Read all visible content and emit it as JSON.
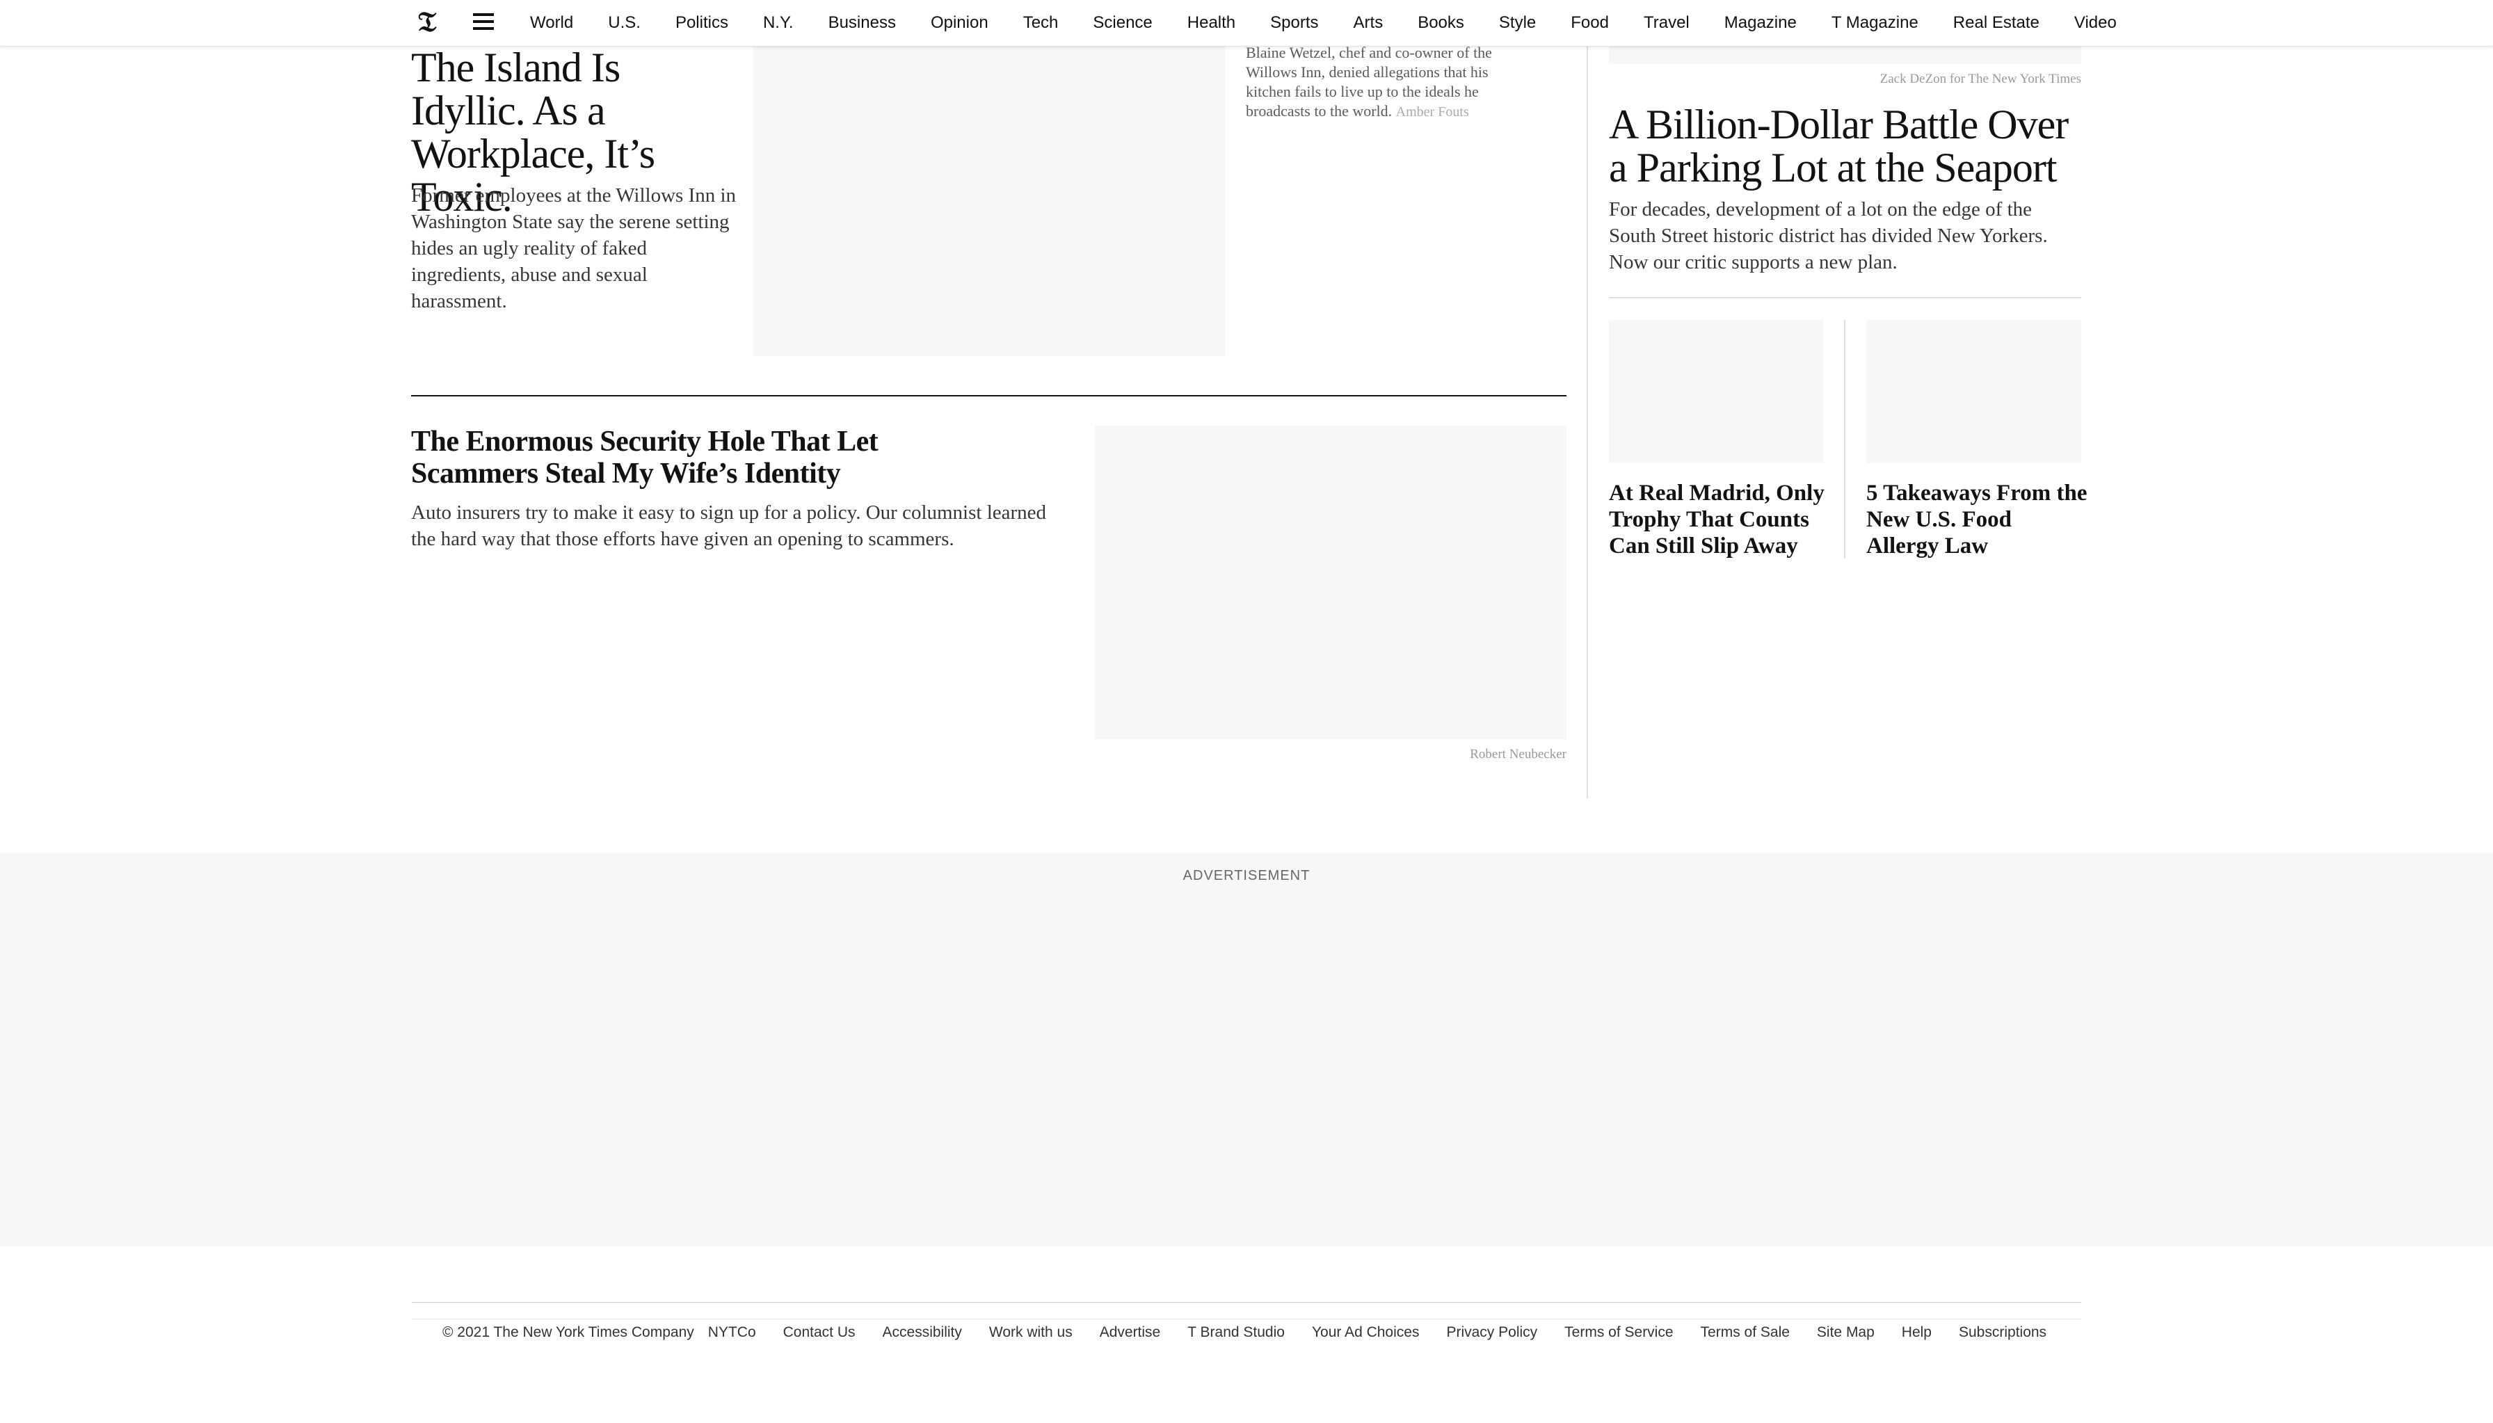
{
  "header": {
    "logo_icon": "nyt-logo-icon",
    "menu_icon": "hamburger-menu-icon",
    "nav": [
      "World",
      "U.S.",
      "Politics",
      "N.Y.",
      "Business",
      "Opinion",
      "Tech",
      "Science",
      "Health",
      "Sports",
      "Arts",
      "Books",
      "Style",
      "Food",
      "Travel",
      "Magazine",
      "T Magazine",
      "Real Estate",
      "Video"
    ]
  },
  "story_island": {
    "headline": "The Island Is Idyllic. As a Workplace, It’s Toxic.",
    "summary": "Former employees at the Willows Inn in Washington State say the serene setting hides an ugly reality of faked ingredients, abuse and sexual harassment.",
    "caption": "Blaine Wetzel, chef and co-owner of the Willows Inn, denied allegations that his kitchen fails to live up to the ideals he broadcasts to the world.",
    "credit": "Amber Fouts"
  },
  "story_security": {
    "headline": "The Enormous Security Hole That Let Scammers Steal My Wife’s Identity",
    "summary": "Auto insurers try to make it easy to sign up for a policy. Our columnist learned the hard way that those efforts have given an opening to scammers.",
    "credit": "Robert Neubecker"
  },
  "story_seaport": {
    "credit": "Zack DeZon for The New York Times",
    "headline": "A Billion-Dollar Battle Over a Parking Lot at the Seaport",
    "summary": "For decades, development of a lot on the edge of the South Street historic district has divided New Yorkers. Now our critic supports a new plan."
  },
  "small_stories": [
    {
      "headline": "At Real Madrid, Only Trophy That Counts Can Still Slip Away"
    },
    {
      "headline": "5 Takeaways From the New U.S. Food Allergy Law"
    }
  ],
  "ad": {
    "label": "ADVERTISEMENT"
  },
  "footer": {
    "copyright": "© 2021 The New York Times Company",
    "links": [
      "NYTCo",
      "Contact Us",
      "Accessibility",
      "Work with us",
      "Advertise",
      "T Brand Studio",
      "Your Ad Choices",
      "Privacy Policy",
      "Terms of Service",
      "Terms of Sale",
      "Site Map",
      "Help",
      "Subscriptions"
    ]
  }
}
